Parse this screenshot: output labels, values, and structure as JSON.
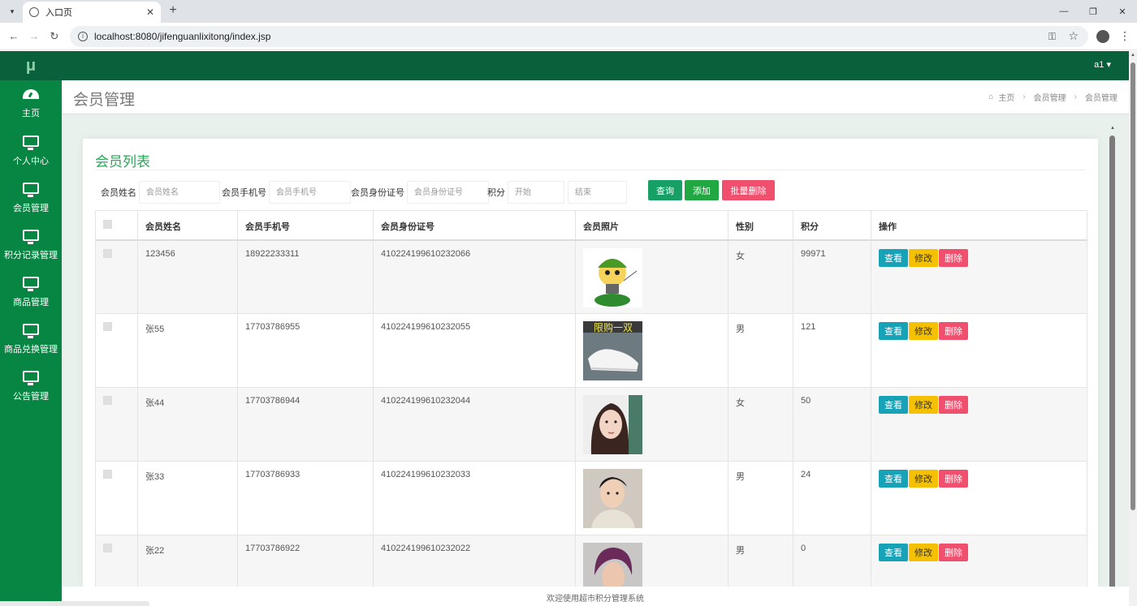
{
  "browser": {
    "tab_title": "入口页",
    "tab_close": "✕",
    "new_tab": "+",
    "url": "localhost:8080/jifenguanlixitong/index.jsp",
    "window_controls": [
      "—",
      "❐",
      "✕"
    ]
  },
  "app": {
    "logo": "μ",
    "user": "a1 ▾",
    "sidebar": [
      {
        "icon": "dashboard-icon",
        "label": "主页"
      },
      {
        "icon": "monitor-icon",
        "label": "个人中心"
      },
      {
        "icon": "monitor-icon",
        "label": "会员管理"
      },
      {
        "icon": "monitor-icon",
        "label": "积分记录管理"
      },
      {
        "icon": "monitor-icon",
        "label": "商品管理"
      },
      {
        "icon": "monitor-icon",
        "label": "商品兑换管理"
      },
      {
        "icon": "monitor-icon",
        "label": "公告管理"
      }
    ]
  },
  "page": {
    "title": "会员管理",
    "breadcrumb": [
      "主页",
      "会员管理",
      "会员管理"
    ]
  },
  "panel": {
    "title": "会员列表",
    "filters": {
      "name_label": "会员姓名",
      "name_placeholder": "会员姓名",
      "phone_label": "会员手机号",
      "phone_placeholder": "会员手机号",
      "id_label": "会员身份证号",
      "id_placeholder": "会员身份证号",
      "points_label": "积分",
      "start_placeholder": "开始",
      "end_placeholder": "结束"
    },
    "buttons": {
      "search": "查询",
      "add": "添加",
      "batch_delete": "批量删除"
    }
  },
  "table": {
    "headers": [
      "会员姓名",
      "会员手机号",
      "会员身份证号",
      "会员照片",
      "性别",
      "积分",
      "操作"
    ],
    "rows": [
      {
        "name": "123456",
        "phone": "18922233311",
        "id_no": "410224199610232066",
        "photo": "cartoon-avatar",
        "gender": "女",
        "points": "99971"
      },
      {
        "name": "张55",
        "phone": "17703786955",
        "id_no": "410224199610232055",
        "photo": "shoes",
        "photo_caption": "限购一双",
        "gender": "男",
        "points": "121"
      },
      {
        "name": "张44",
        "phone": "17703786944",
        "id_no": "410224199610232044",
        "photo": "woman-portrait",
        "gender": "女",
        "points": "50"
      },
      {
        "name": "张33",
        "phone": "17703786933",
        "id_no": "410224199610232033",
        "photo": "man-portrait",
        "gender": "男",
        "points": "24"
      },
      {
        "name": "张22",
        "phone": "17703786922",
        "id_no": "410224199610232022",
        "photo": "man-purple-hair",
        "gender": "男",
        "points": "0"
      }
    ],
    "actions": {
      "view": "查看",
      "edit": "修改",
      "delete": "删除"
    }
  },
  "footer": "欢迎使用超市积分管理系统",
  "colors": {
    "sidebar": "#078543",
    "topbar": "#08613a",
    "accent": "#2ea45a",
    "search_btn": "#16a066",
    "add_btn": "#21a842",
    "delete_btn": "#f0506e",
    "view_btn": "#17a2b8",
    "edit_btn": "#f5c000"
  }
}
